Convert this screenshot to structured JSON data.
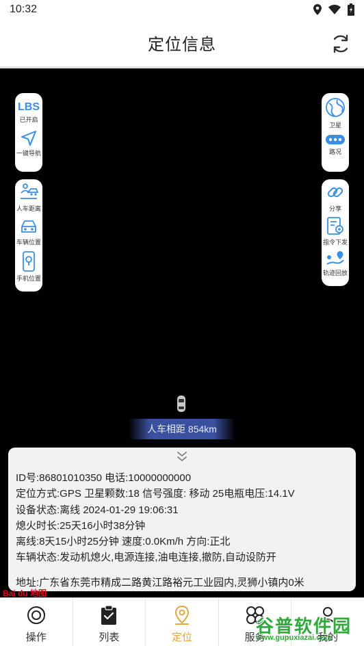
{
  "status_bar": {
    "time": "10:32"
  },
  "header": {
    "title": "定位信息"
  },
  "left_panel_top": [
    {
      "label": "已开启",
      "icon": "lbs-icon",
      "text": "LBS"
    },
    {
      "label": "一键导航",
      "icon": "navigate-arrow-icon"
    }
  ],
  "left_panel_bottom": [
    {
      "label": "人车距离",
      "icon": "person-car-distance-icon"
    },
    {
      "label": "车辆位置",
      "icon": "car-location-icon"
    },
    {
      "label": "手机位置",
      "icon": "phone-location-icon"
    }
  ],
  "right_panel_top": [
    {
      "label": "卫星",
      "icon": "satellite-map-icon"
    },
    {
      "label": "路况",
      "icon": "traffic-icon"
    }
  ],
  "right_panel_bottom": [
    {
      "label": "分享",
      "icon": "share-link-icon"
    },
    {
      "label": "指令下发",
      "icon": "command-icon"
    },
    {
      "label": "轨迹回放",
      "icon": "track-playback-icon"
    }
  ],
  "distance": {
    "text": "人车相距 854km"
  },
  "info": {
    "id_line": "ID号:86801010350  电话:10000000000",
    "mode_line": "定位方式:GPS 卫星颗数:18 信号强度: 移动 25电瓶电压:14.1V",
    "device_line": "设备状态:离线  2024-01-29 19:06:31",
    "off_line": "熄火时长:25天16小时38分钟",
    "offline_line": "离线:8天15小时25分钟 速度:0.0Km/h  方向:正北",
    "vehicle_line": "车辆状态:发动机熄火,电源连接,油电连接,撤防,自动设防开",
    "address_line": "地址:广东省东莞市精成二路黄江路裕元工业园内,灵狮小镇内0米"
  },
  "map_logo": {
    "text": "Bai du 地图"
  },
  "bottom_nav": [
    {
      "label": "操作",
      "icon": "operate-icon"
    },
    {
      "label": "列表",
      "icon": "list-clipboard-icon"
    },
    {
      "label": "定位",
      "icon": "location-pin-icon",
      "active": true
    },
    {
      "label": "服务",
      "icon": "service-icon"
    },
    {
      "label": "我的",
      "icon": "profile-icon"
    }
  ],
  "watermark": {
    "title": "谷普软件园",
    "url": "www.gupuxiazai.com"
  },
  "colors": {
    "accent": "#3a8ee6",
    "active_nav": "#e2a83c",
    "watermark": "#2eaa3a"
  }
}
